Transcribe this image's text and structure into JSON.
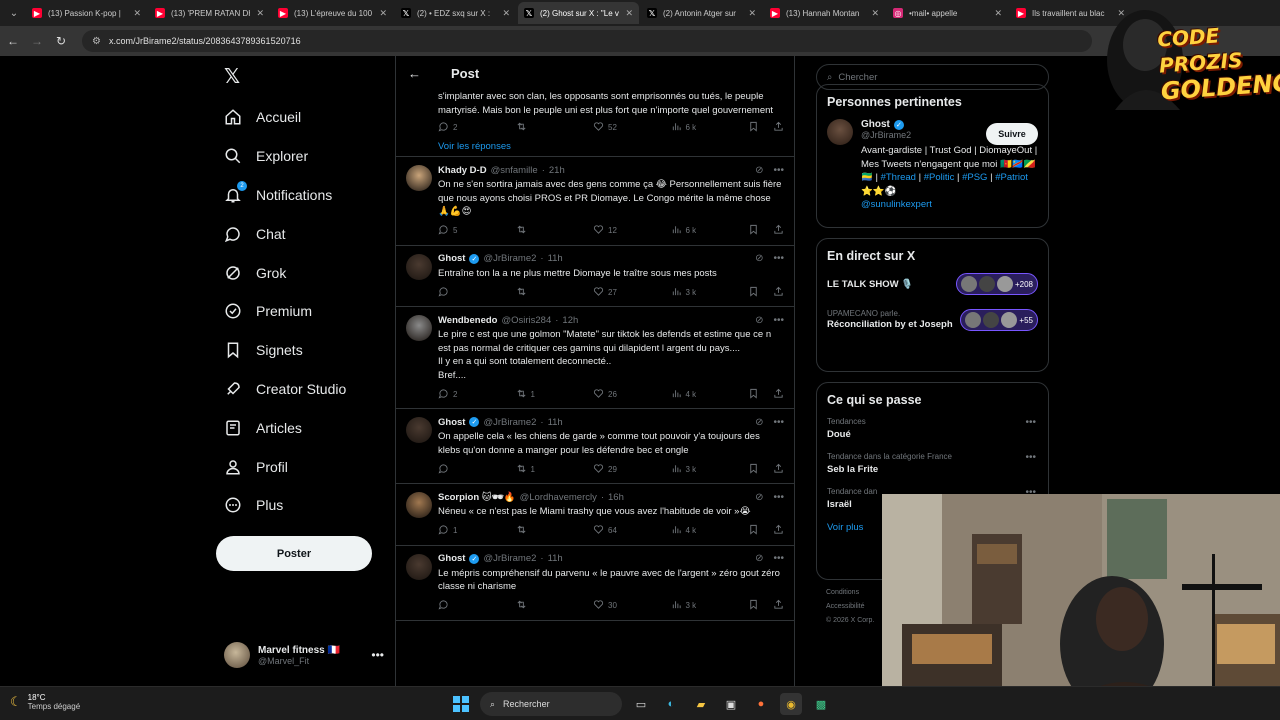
{
  "browser": {
    "tabs": [
      {
        "title": "(13) Passion K-pop | ",
        "favicon": "youtube-icon",
        "active": false
      },
      {
        "title": "(13) 'PREM RATAN DH",
        "favicon": "youtube-icon",
        "active": false
      },
      {
        "title": "(13) L'épreuve du 100",
        "favicon": "youtube-icon",
        "active": false
      },
      {
        "title": "(2) • EDZ sxq sur X :",
        "favicon": "x-icon",
        "active": false
      },
      {
        "title": "(2) Ghost sur X : \"Le v",
        "favicon": "x-icon",
        "active": true
      },
      {
        "title": "(2) Antonin Atger sur",
        "favicon": "x-icon",
        "active": false
      },
      {
        "title": "(13) Hannah Montan",
        "favicon": "youtube-icon",
        "active": false
      },
      {
        "title": "•mail• appelle",
        "favicon": "instagram-icon",
        "active": false
      },
      {
        "title": "Ils travaillent au blac",
        "favicon": "youtube-icon",
        "active": false
      }
    ],
    "url": "x.com/JrBirame2/status/2083643789361520716"
  },
  "nav": {
    "items": [
      {
        "label": "Accueil",
        "icon": "home-icon"
      },
      {
        "label": "Explorer",
        "icon": "search-icon"
      },
      {
        "label": "Notifications",
        "icon": "bell-icon",
        "badge": "2"
      },
      {
        "label": "Chat",
        "icon": "chat-icon"
      },
      {
        "label": "Grok",
        "icon": "grok-icon"
      },
      {
        "label": "Premium",
        "icon": "premium-icon"
      },
      {
        "label": "Signets",
        "icon": "bookmark-icon"
      },
      {
        "label": "Creator Studio",
        "icon": "rocket-icon"
      },
      {
        "label": "Articles",
        "icon": "article-icon"
      },
      {
        "label": "Profil",
        "icon": "profile-icon"
      },
      {
        "label": "Plus",
        "icon": "more-icon"
      }
    ],
    "post_button": "Poster",
    "account": {
      "name": "Marvel fitness 🇫🇷",
      "handle": "@Marvel_Fit",
      "more": "•••"
    }
  },
  "timeline": {
    "header": "Post",
    "top_tweet": {
      "text": "s'implanter avec son clan, les opposants sont emprisonnés ou tués, le peuple martyrisé. Mais bon le peuple uni est plus fort que n'importe quel gouvernement",
      "replies": "2",
      "retweets": "",
      "likes": "52",
      "views": "6 k"
    },
    "see_replies": "Voir les réponses",
    "tweets": [
      {
        "name": "Khady D-D",
        "handle": "@snfamille",
        "time": "21h",
        "verified": false,
        "avatar_color": "#c9a47a",
        "lines": [
          "On ne s'en sortira jamais avec des gens comme ça 😂 Personnellement suis fière que nous ayons choisi PROS et PR Diomaye. Le Congo mérite la même chose 🙏💪😍"
        ],
        "replies": "5",
        "retweets": "",
        "likes": "12",
        "views": "6 k"
      },
      {
        "name": "Ghost",
        "handle": "@JrBirame2",
        "time": "11h",
        "verified": true,
        "avatar_color": "#4a3a30",
        "lines": [
          "Entraîne ton la a ne plus mettre Diomaye le traître sous mes posts"
        ],
        "replies": "",
        "retweets": "",
        "likes": "27",
        "views": "3 k"
      },
      {
        "name": "Wendbenedo",
        "handle": "@Osiris284",
        "time": "12h",
        "verified": false,
        "avatar_color": "#8a8a8a",
        "lines": [
          "Le pire c est que une golmon \"Matete\" sur tiktok les defends et estime que ce n est pas normal de critiquer ces gamins qui dilapident l argent du pays....",
          "Il y en a qui sont totalement deconnecté..",
          "Bref...."
        ],
        "replies": "2",
        "retweets": "1",
        "likes": "26",
        "views": "4 k"
      },
      {
        "name": "Ghost",
        "handle": "@JrBirame2",
        "time": "11h",
        "verified": true,
        "avatar_color": "#4a3a30",
        "lines": [
          "On appelle cela « les chiens de garde » comme tout pouvoir y'a toujours des klebs qu'on donne a manger pour les défendre bec et ongle"
        ],
        "replies": "",
        "retweets": "1",
        "likes": "29",
        "views": "3 k"
      },
      {
        "name": "Scorpion 🐱🕶🔥",
        "handle": "@Lordhavemercly",
        "time": "16h",
        "verified": false,
        "avatar_color": "#a07850",
        "lines": [
          "Néneu « ce n'est pas le Miami trashy que vous avez l'habitude de voir »😭"
        ],
        "replies": "1",
        "retweets": "",
        "likes": "64",
        "views": "4 k"
      },
      {
        "name": "Ghost",
        "handle": "@JrBirame2",
        "time": "11h",
        "verified": true,
        "avatar_color": "#4a3a30",
        "lines": [
          "Le mépris compréhensif du parvenu « le pauvre avec de l'argent » zéro gout zéro classe ni charisme"
        ],
        "replies": "",
        "retweets": "",
        "likes": "30",
        "views": "3 k"
      }
    ]
  },
  "right": {
    "search_placeholder": "Chercher",
    "relevant": {
      "title": "Personnes pertinentes",
      "name": "Ghost",
      "handle": "@JrBirame2",
      "follow": "Suivre",
      "bio_plain": "Avant-gardiste | Trust God | DiomayeOut | Mes Tweets n'engagent que moi 🇨🇲🇨🇩🇨🇬🇬🇦 | ",
      "bio_links": [
        "#Thread",
        "#Politic",
        "#PSG",
        "#Patriot",
        "@sunulinkexpert"
      ],
      "bio_sep1": " | ",
      "bio_tail": " ⭐⭐⚽"
    },
    "live": {
      "title": "En direct sur X",
      "items": [
        {
          "title": "LE TALK SHOW 🎙️",
          "sub": "",
          "count": "+208"
        },
        {
          "title": "Réconciliation by et Joseph",
          "sub": "UPAMECANO parle.",
          "count": "+55"
        }
      ]
    },
    "trends": {
      "title": "Ce qui se passe",
      "items": [
        {
          "category": "Tendances",
          "name": "Doué"
        },
        {
          "category": "Tendance dans la catégorie France",
          "name": "Seb la Frite"
        },
        {
          "category": "Tendance dan",
          "name": "Israël"
        }
      ],
      "see_more": "Voir plus"
    },
    "footer": [
      "Conditions",
      "Accessibilité",
      "© 2026 X Corp."
    ]
  },
  "overlay": {
    "brand_line1": "CODE PROZIS",
    "brand_line2": "GOLDENG"
  },
  "taskbar": {
    "temp": "18°C",
    "weather": "Temps dégagé",
    "search": "Rechercher"
  }
}
